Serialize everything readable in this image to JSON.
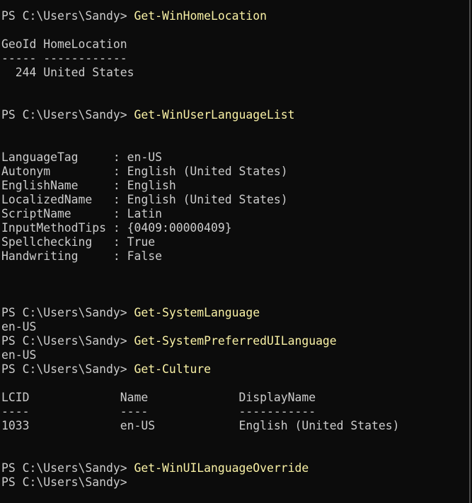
{
  "terminal": {
    "lines": [
      {
        "prompt": "PS C:\\Users\\Sandy> ",
        "command": "Get-WinHomeLocation"
      },
      {
        "text": ""
      },
      {
        "text": "GeoId HomeLocation"
      },
      {
        "text": "----- ------------"
      },
      {
        "text": "  244 United States"
      },
      {
        "text": ""
      },
      {
        "text": ""
      },
      {
        "prompt": "PS C:\\Users\\Sandy> ",
        "command": "Get-WinUserLanguageList"
      },
      {
        "text": ""
      },
      {
        "text": ""
      },
      {
        "text": "LanguageTag     : en-US"
      },
      {
        "text": "Autonym         : English (United States)"
      },
      {
        "text": "EnglishName     : English"
      },
      {
        "text": "LocalizedName   : English (United States)"
      },
      {
        "text": "ScriptName      : Latin"
      },
      {
        "text": "InputMethodTips : {0409:00000409}"
      },
      {
        "text": "Spellchecking   : True"
      },
      {
        "text": "Handwriting     : False"
      },
      {
        "text": ""
      },
      {
        "text": ""
      },
      {
        "text": ""
      },
      {
        "prompt": "PS C:\\Users\\Sandy> ",
        "command": "Get-SystemLanguage"
      },
      {
        "text": "en-US"
      },
      {
        "prompt": "PS C:\\Users\\Sandy> ",
        "command": "Get-SystemPreferredUILanguage"
      },
      {
        "text": "en-US"
      },
      {
        "prompt": "PS C:\\Users\\Sandy> ",
        "command": "Get-Culture"
      },
      {
        "text": ""
      },
      {
        "text": "LCID             Name             DisplayName"
      },
      {
        "text": "----             ----             -----------"
      },
      {
        "text": "1033             en-US            English (United States)"
      },
      {
        "text": ""
      },
      {
        "text": ""
      },
      {
        "prompt": "PS C:\\Users\\Sandy> ",
        "command": "Get-WinUILanguageOverride"
      },
      {
        "prompt": "PS C:\\Users\\Sandy> ",
        "command": ""
      }
    ]
  },
  "colors": {
    "background": "#0c0c0c",
    "text": "#cccccc",
    "command": "#f9f1a5"
  }
}
